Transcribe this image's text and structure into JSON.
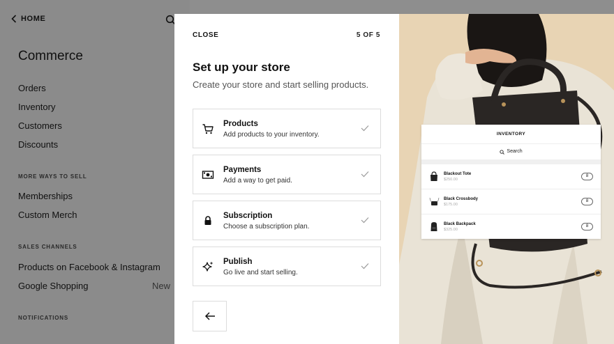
{
  "sidebar": {
    "home_label": "HOME",
    "title": "Commerce",
    "main_items": [
      "Orders",
      "Inventory",
      "Customers",
      "Discounts"
    ],
    "more_ways_label": "MORE WAYS TO SELL",
    "more_items": [
      "Memberships",
      "Custom Merch"
    ],
    "sales_channels_label": "SALES CHANNELS",
    "channel_items": [
      "Products on Facebook & Instagram",
      "Google Shopping"
    ],
    "google_badge": "New",
    "notifications_label": "NOTIFICATIONS"
  },
  "modal": {
    "close_label": "CLOSE",
    "step": "5 OF 5",
    "title": "Set up your store",
    "subtitle": "Create your store and start selling products.",
    "cards": [
      {
        "title": "Products",
        "desc": "Add products to your inventory.",
        "icon": "cart-icon"
      },
      {
        "title": "Payments",
        "desc": "Add a way to get paid.",
        "icon": "cash-icon"
      },
      {
        "title": "Subscription",
        "desc": "Choose a subscription plan.",
        "icon": "lock-icon"
      },
      {
        "title": "Publish",
        "desc": "Go live and start selling.",
        "icon": "sparkle-icon"
      }
    ]
  },
  "inventory": {
    "header": "INVENTORY",
    "search_label": "Search",
    "items": [
      {
        "name": "Blackout Tote",
        "price": "$250.00",
        "qty": "8"
      },
      {
        "name": "Black Crossbody",
        "price": "$175.00",
        "qty": "8"
      },
      {
        "name": "Black Backpack",
        "price": "$325.00",
        "qty": "8"
      }
    ]
  }
}
